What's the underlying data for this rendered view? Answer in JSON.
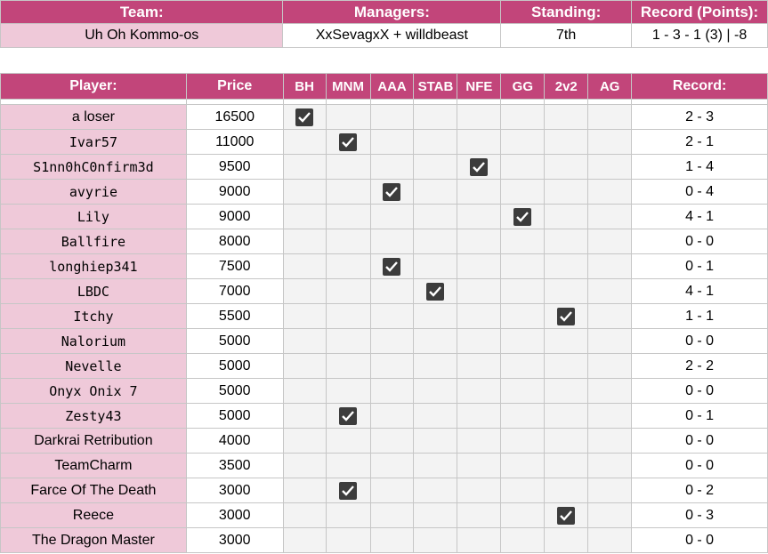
{
  "team_header": {
    "team_label": "Team:",
    "managers_label": "Managers:",
    "standing_label": "Standing:",
    "record_label": "Record (Points):",
    "team_value": "Uh Oh Kommo-os",
    "managers_value": "XxSevagxX + willdbeast",
    "standing_value": "7th",
    "record_value": "1 - 3 - 1 (3) | -8"
  },
  "player_header": {
    "player_label": "Player:",
    "price_label": "Price",
    "columns": [
      "BH",
      "MNM",
      "AAA",
      "STAB",
      "NFE",
      "GG",
      "2v2",
      "AG"
    ],
    "record_label": "Record:"
  },
  "players": [
    {
      "name": "a loser",
      "price": "16500",
      "check": "BH",
      "record": "2 - 3"
    },
    {
      "name": "Ivar57",
      "price": "11000",
      "check": "MNM",
      "record": "2 - 1"
    },
    {
      "name": "S1nn0hC0nfirm3d",
      "price": "9500",
      "check": "NFE",
      "record": "1 - 4"
    },
    {
      "name": "avyrie",
      "price": "9000",
      "check": "AAA",
      "record": "0 - 4"
    },
    {
      "name": "Lily",
      "price": "9000",
      "check": "GG",
      "record": "4 - 1"
    },
    {
      "name": "Ballfire",
      "price": "8000",
      "check": "",
      "record": "0 - 0"
    },
    {
      "name": "longhiep341",
      "price": "7500",
      "check": "AAA",
      "record": "0 - 1"
    },
    {
      "name": "LBDC",
      "price": "7000",
      "check": "STAB",
      "record": "4 - 1"
    },
    {
      "name": "Itchy",
      "price": "5500",
      "check": "2v2",
      "record": "1 - 1"
    },
    {
      "name": "Nalorium",
      "price": "5000",
      "check": "",
      "record": "0 - 0"
    },
    {
      "name": "Nevelle",
      "price": "5000",
      "check": "",
      "record": "2 - 2"
    },
    {
      "name": "Onyx Onix 7",
      "price": "5000",
      "check": "",
      "record": "0 - 0"
    },
    {
      "name": "Zesty43",
      "price": "5000",
      "check": "MNM",
      "record": "0 - 1"
    },
    {
      "name": "Darkrai Retribution",
      "price": "4000",
      "check": "",
      "record": "0 - 0"
    },
    {
      "name": "TeamCharm",
      "price": "3500",
      "check": "",
      "record": "0 - 0"
    },
    {
      "name": "Farce Of The Death",
      "price": "3000",
      "check": "MNM",
      "record": "0 - 2"
    },
    {
      "name": "Reece",
      "price": "3000",
      "check": "2v2",
      "record": "0 - 3"
    },
    {
      "name": "The Dragon Master",
      "price": "3000",
      "check": "",
      "record": "0 - 0"
    }
  ],
  "colors": {
    "header_bg": "#c2457a",
    "name_bg": "#efc9d9",
    "checkbox_bg": "#f3f3f3",
    "check_fill": "#3c3c3c"
  },
  "icons": {
    "checkbox": "checked-checkbox-icon"
  }
}
